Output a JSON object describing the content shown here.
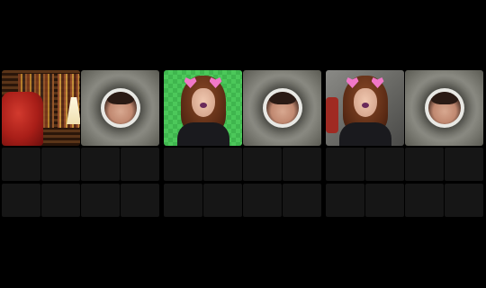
{
  "strip": {
    "groups": [
      {
        "id": "group-1",
        "tiles": [
          {
            "icon": "library-background-thumbnail"
          },
          {
            "icon": "blurred-camera-circle-thumbnail"
          }
        ],
        "empty_slots": 8
      },
      {
        "id": "group-2",
        "tiles": [
          {
            "icon": "green-screen-dog-filter-thumbnail"
          },
          {
            "icon": "blurred-camera-circle-thumbnail"
          }
        ],
        "empty_slots": 8
      },
      {
        "id": "group-3",
        "tiles": [
          {
            "icon": "gray-background-dog-filter-thumbnail"
          },
          {
            "icon": "blurred-camera-circle-thumbnail"
          }
        ],
        "empty_slots": 8
      }
    ]
  },
  "colors": {
    "background": "#000000",
    "empty_slot": "#161616",
    "green_screen": "#4cc85a"
  }
}
